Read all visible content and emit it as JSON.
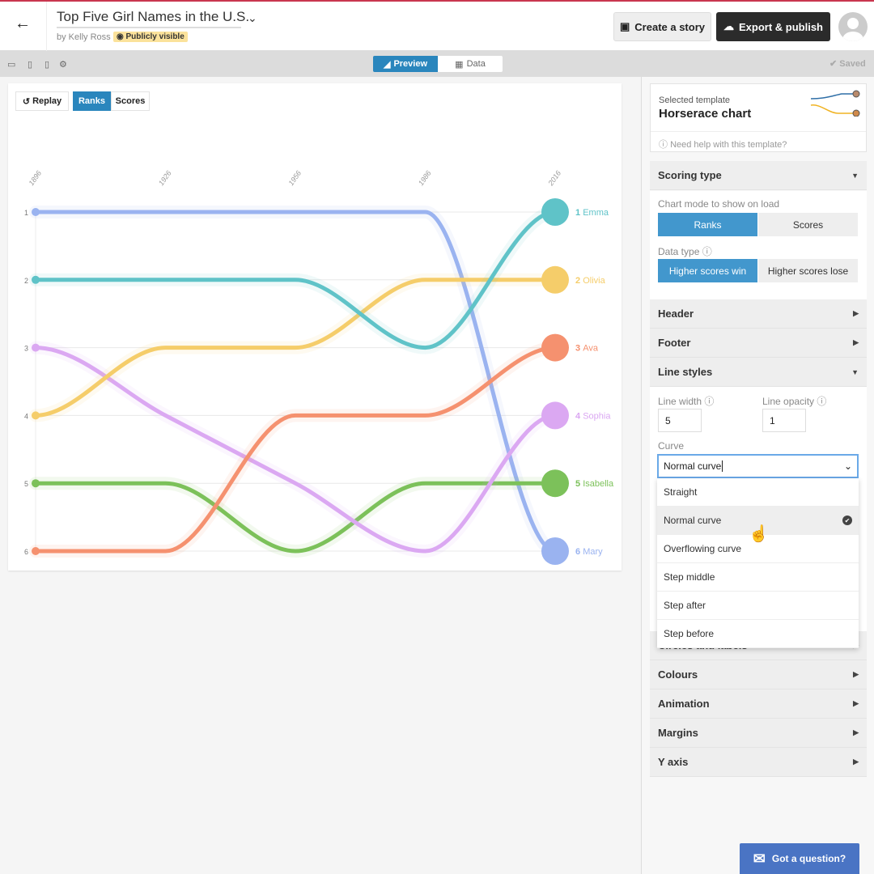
{
  "header": {
    "title": "Top Five Girl Names in the U.S.",
    "byline": "by Kelly Ross",
    "visibility": "Publicly visible",
    "create_story": "Create a story",
    "export": "Export & publish"
  },
  "toolbar": {
    "preview": "Preview",
    "data": "Data",
    "saved": "✔ Saved"
  },
  "chart_controls": {
    "replay": "Replay",
    "ranks": "Ranks",
    "scores": "Scores"
  },
  "panel": {
    "template_label": "Selected template",
    "template_name": "Horserace chart",
    "help": "Need help with this template?",
    "scoring": {
      "title": "Scoring type",
      "mode_label": "Chart mode to show on load",
      "ranks": "Ranks",
      "scores": "Scores",
      "dtype_label": "Data type",
      "win": "Higher scores win",
      "lose": "Higher scores lose"
    },
    "sections": {
      "header": "Header",
      "footer": "Footer",
      "line_styles": "Line styles",
      "circles": "Circles and labels",
      "colours": "Colours",
      "animation": "Animation",
      "margins": "Margins",
      "yaxis": "Y axis"
    },
    "line": {
      "width_label": "Line width",
      "width": "5",
      "opacity_label": "Line opacity",
      "opacity": "1",
      "curve_label": "Curve",
      "curve": "Normal curve",
      "options": [
        "Straight",
        "Normal curve",
        "Overflowing curve",
        "Step middle",
        "Step after",
        "Step before"
      ]
    },
    "ask": "Got a question?"
  },
  "chart_data": {
    "type": "line",
    "mode": "ranks",
    "x": [
      1896,
      1926,
      1956,
      1986,
      2016
    ],
    "y_ticks": [
      1,
      2,
      3,
      4,
      5,
      6
    ],
    "ylim": [
      1,
      6
    ],
    "grid": true,
    "series": [
      {
        "name": "Emma",
        "color": "#5fc3c8",
        "values": [
          2,
          2,
          2,
          3,
          1
        ]
      },
      {
        "name": "Olivia",
        "color": "#f5cd6a",
        "values": [
          4,
          3,
          3,
          2,
          2
        ]
      },
      {
        "name": "Ava",
        "color": "#f5916f",
        "values": [
          6,
          6,
          4,
          4,
          3
        ]
      },
      {
        "name": "Sophia",
        "color": "#dba8f2",
        "values": [
          3,
          4,
          5,
          6,
          4
        ]
      },
      {
        "name": "Isabella",
        "color": "#7cc15a",
        "values": [
          5,
          5,
          6,
          5,
          5
        ]
      },
      {
        "name": "Mary",
        "color": "#9ab3f0",
        "values": [
          1,
          1,
          1,
          1,
          6
        ]
      }
    ]
  }
}
